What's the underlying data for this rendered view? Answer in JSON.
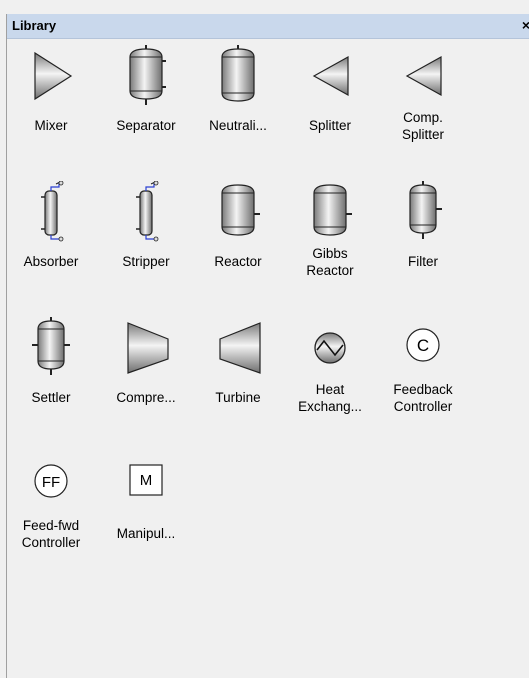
{
  "panel": {
    "title": "Library",
    "close": "×"
  },
  "items": [
    {
      "label": "Mixer",
      "icon": "mixer-icon"
    },
    {
      "label": "Separator",
      "icon": "separator-icon"
    },
    {
      "label": "Neutrali...",
      "icon": "neutralizer-icon"
    },
    {
      "label": "Splitter",
      "icon": "splitter-icon"
    },
    {
      "label": "Comp. Splitter",
      "icon": "comp-splitter-icon"
    },
    {
      "label": "Absorber",
      "icon": "absorber-icon"
    },
    {
      "label": "Stripper",
      "icon": "stripper-icon"
    },
    {
      "label": "Reactor",
      "icon": "reactor-icon"
    },
    {
      "label": "Gibbs Reactor",
      "icon": "gibbs-reactor-icon"
    },
    {
      "label": "Filter",
      "icon": "filter-icon"
    },
    {
      "label": "Settler",
      "icon": "settler-icon"
    },
    {
      "label": "Compre...",
      "icon": "compressor-icon"
    },
    {
      "label": "Turbine",
      "icon": "turbine-icon"
    },
    {
      "label": "Heat Exchang...",
      "icon": "heat-exchanger-icon"
    },
    {
      "label": "Feedback Controller",
      "icon": "feedback-controller-icon",
      "text": "C"
    },
    {
      "label": "Feed-fwd Controller",
      "icon": "feedfwd-controller-icon",
      "text": "FF"
    },
    {
      "label": "Manipul...",
      "icon": "manipulator-icon",
      "text": "M"
    }
  ]
}
